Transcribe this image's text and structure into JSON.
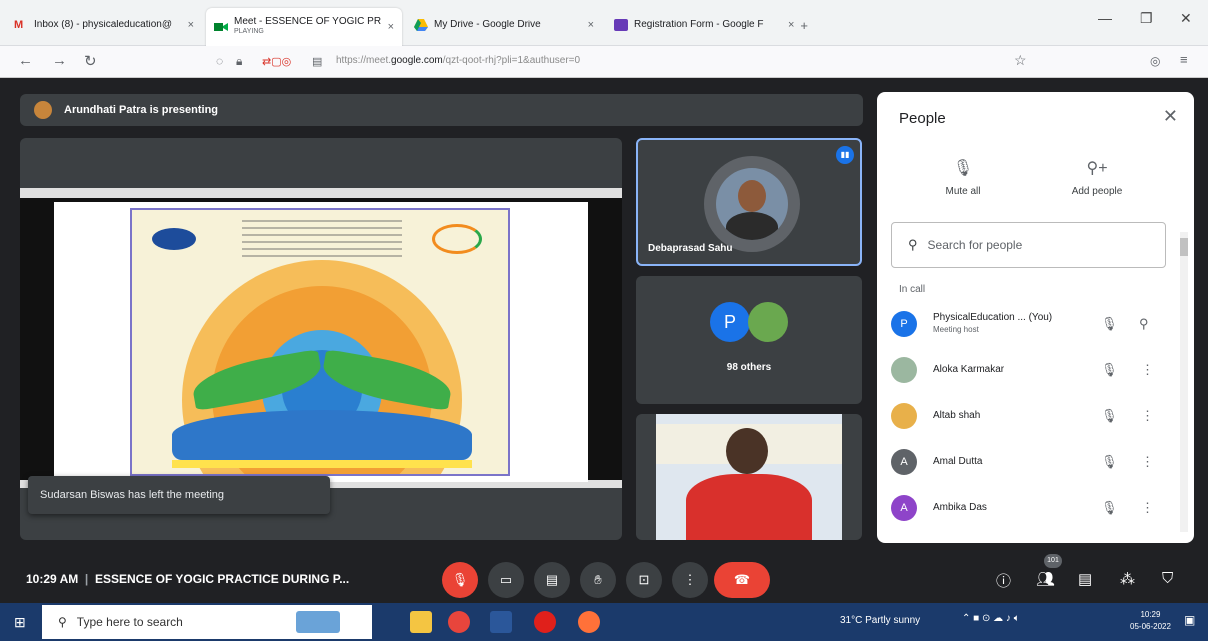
{
  "browser": {
    "tabs": [
      {
        "title": "Inbox (8) - physicaleducation@",
        "subtitle": ""
      },
      {
        "title": "Meet - ESSENCE OF YOGIC PR",
        "subtitle": "PLAYING"
      },
      {
        "title": "My Drive - Google Drive",
        "subtitle": ""
      },
      {
        "title": "Registration Form - Google F",
        "subtitle": ""
      }
    ],
    "url_prefix": "https://meet.",
    "url_domain": "google.com",
    "url_suffix": "/qzt-qoot-rhj?pli=1&authuser=0",
    "close_glyph": "×",
    "window_minimize": "—",
    "window_maximize": "❐",
    "window_close": "✕"
  },
  "meet": {
    "presenter_banner": "Arundhati Patra is presenting",
    "toast": "Sudarsan Biswas has left the meeting",
    "tiles": [
      {
        "name": "Debaprasad Sahu"
      },
      {
        "name": "98 others",
        "initial": "P"
      }
    ],
    "controls": {
      "time": "10:29 AM",
      "separator": "|",
      "meeting_title": "ESSENCE OF YOGIC PRACTICE DURING P...",
      "participant_count": "101"
    }
  },
  "people_panel": {
    "title": "People",
    "mute_all": "Mute all",
    "add_people": "Add people",
    "search_placeholder": "Search for people",
    "section": "In call",
    "participants": [
      {
        "name": "PhysicalEducation ... (You)",
        "role": "Meeting host",
        "initial": "P",
        "color": "#1a73e8"
      },
      {
        "name": "Aloka Karmakar",
        "role": "",
        "initial": "",
        "color": "#9bb7a0"
      },
      {
        "name": "Altab shah",
        "role": "",
        "initial": "",
        "color": "#e8b04a"
      },
      {
        "name": "Amal Dutta",
        "role": "",
        "initial": "A",
        "color": "#5f6368"
      },
      {
        "name": "Ambika Das",
        "role": "",
        "initial": "A",
        "color": "#8e44c9"
      }
    ]
  },
  "taskbar": {
    "search_placeholder": "Type here to search",
    "weather": "31°C  Partly sunny",
    "time": "10:29",
    "date": "05-06-2022"
  }
}
